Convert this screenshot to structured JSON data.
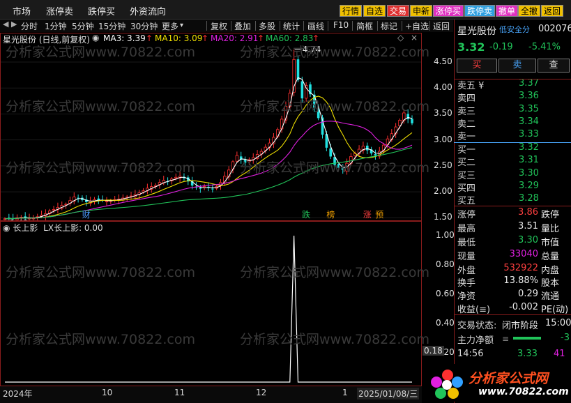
{
  "menu": [
    "市场",
    "涨停卖",
    "跌停买",
    "外资流向"
  ],
  "quick_buttons": [
    {
      "label": "行情",
      "bg": "#f0c000",
      "fg": "#000"
    },
    {
      "label": "自选",
      "bg": "#f0c000",
      "fg": "#000"
    },
    {
      "label": "交易",
      "bg": "#e03030",
      "fg": "#fff"
    },
    {
      "label": "申新",
      "bg": "#f0c000",
      "fg": "#000"
    },
    {
      "label": "涨停买",
      "bg": "#e030c0",
      "fg": "#fff"
    },
    {
      "label": "跌停卖",
      "bg": "#30a0e0",
      "fg": "#fff"
    },
    {
      "label": "撤单",
      "bg": "#e030c0",
      "fg": "#fff"
    },
    {
      "label": "全撤",
      "bg": "#f0c000",
      "fg": "#000"
    },
    {
      "label": "返回",
      "bg": "#f0c000",
      "fg": "#000"
    }
  ],
  "toolbar": {
    "pager": "◀ ▶",
    "periods": [
      "分时",
      "1分钟",
      "5分钟",
      "15分钟",
      "30分钟",
      "更多"
    ],
    "more_arrow": "▾",
    "tools": [
      "复权",
      "叠加",
      "多股",
      "统计",
      "画线",
      "F10",
      "简框",
      "标记",
      "+自选",
      "返回"
    ]
  },
  "legend": {
    "stock": "星光股份 (日线,前复权)",
    "ma3": "MA3: 3.39",
    "ma10": "MA10: 3.09",
    "ma20": "MA20: 2.91",
    "ma60": "MA60: 2.83",
    "arrow": "↑"
  },
  "colors": {
    "ma3": "#ffffff",
    "ma10": "#f0e000",
    "ma20": "#e020e0",
    "ma60": "#21c45a",
    "up": "#ff3030",
    "down": "#20e0e0"
  },
  "chart_data": {
    "type": "candlestick",
    "y_ticks": [
      "4.50",
      "4.00",
      "3.50",
      "3.00",
      "2.50",
      "2.00",
      "1.50"
    ],
    "ylim": [
      1.45,
      4.85
    ],
    "high_label": "4.74",
    "low_label": "1.42",
    "event_markers": [
      {
        "text": "财",
        "color": "#4a9bff"
      },
      {
        "text": "跌",
        "color": "#21c45a"
      },
      {
        "text": "榜",
        "color": "#f0a000"
      },
      {
        "text": "涨",
        "color": "#ff4040"
      },
      {
        "text": "预",
        "color": "#f0a000"
      }
    ],
    "close": [
      1.48,
      1.49,
      1.48,
      1.5,
      1.51,
      1.5,
      1.49,
      1.5,
      1.52,
      1.55,
      1.58,
      1.63,
      1.66,
      1.7,
      1.74,
      1.76,
      1.83,
      1.9,
      1.87,
      1.84,
      1.8,
      1.82,
      1.85,
      1.84,
      1.83,
      1.82,
      1.83,
      1.85,
      1.86,
      1.88,
      1.9,
      1.92,
      1.95,
      1.98,
      2.02,
      2.07,
      2.1,
      2.12,
      2.18,
      2.22,
      2.2,
      2.25,
      2.28,
      2.3,
      2.26,
      2.2,
      2.12,
      2.08,
      2.06,
      2.1,
      2.08,
      2.06,
      2.1,
      2.18,
      2.3,
      2.42,
      2.58,
      2.7,
      2.62,
      2.56,
      2.62,
      2.66,
      2.72,
      2.78,
      2.86,
      2.94,
      3.05,
      3.2,
      3.4,
      3.65,
      3.9,
      4.55,
      4.15,
      3.8,
      4.05,
      3.88,
      3.62,
      3.42,
      3.1,
      2.85,
      2.68,
      2.52,
      2.46,
      2.42,
      2.55,
      2.68,
      2.74,
      2.82,
      2.88,
      2.8,
      2.74,
      2.7,
      2.78,
      2.9,
      3.02,
      3.12,
      3.25,
      3.38,
      3.52,
      3.4,
      3.32
    ]
  },
  "sub_chart": {
    "title": "长上影",
    "indicator": "LX长上影: 0.00",
    "y_ticks": [
      "1.00",
      "0.80",
      "0.60",
      "0.40",
      "0.20"
    ],
    "spike_index": 71,
    "spike_value": 1.0,
    "cursor_value": "0.18"
  },
  "x_axis": [
    "2024年",
    "10",
    "11",
    "12",
    "1",
    "2025/01/08/三"
  ],
  "right_panel": {
    "name": "星光股份",
    "risk_tag": "低安全分",
    "code": "002076",
    "price": "3.32",
    "change": "-0.19",
    "change_pct": "-5.41%",
    "buttons": [
      "买",
      "卖",
      "查"
    ],
    "asks": [
      {
        "label": "卖五 ¥",
        "price": "3.37"
      },
      {
        "label": "卖四",
        "price": "3.36"
      },
      {
        "label": "卖三",
        "price": "3.35"
      },
      {
        "label": "卖二",
        "price": "3.34"
      },
      {
        "label": "卖一",
        "price": "3.33"
      }
    ],
    "bids": [
      {
        "label": "买一",
        "price": "3.32"
      },
      {
        "label": "买二",
        "price": "3.31"
      },
      {
        "label": "买三",
        "price": "3.30"
      },
      {
        "label": "买四",
        "price": "3.29"
      },
      {
        "label": "买五",
        "price": "3.28"
      }
    ],
    "stats": [
      {
        "l1": "涨停",
        "v1": "3.86",
        "c1": "red",
        "l2": "跌停"
      },
      {
        "l1": "最高",
        "v1": "3.51",
        "c1": "white",
        "l2": "量比"
      },
      {
        "l1": "最低",
        "v1": "3.30",
        "c1": "green",
        "l2": "市值"
      },
      {
        "l1": "现量",
        "v1": "33040",
        "c1": "mag",
        "l2": "总量"
      },
      {
        "l1": "外盘",
        "v1": "532922",
        "c1": "red",
        "l2": "内盘"
      }
    ],
    "stats2": [
      {
        "l1": "换手",
        "v1": "13.88%",
        "l2": "股本"
      },
      {
        "l1": "净资",
        "v1": "0.29",
        "l2": "流通"
      },
      {
        "l1": "收益(≡)",
        "v1": "-0.002",
        "l2": "PE(动)"
      }
    ],
    "trade_status_label": "交易状态:",
    "trade_status": "闭市阶段",
    "trade_time": "15:00",
    "net_flow_label": "主力净额",
    "net_flow_value": "-3",
    "tick_time": "14:56",
    "tick_price": "3.33",
    "tick_vol": "41"
  },
  "watermark": {
    "text": "分析家公式网www.70822.com",
    "brand": "分析家公式网",
    "url": "www.70822.com"
  }
}
